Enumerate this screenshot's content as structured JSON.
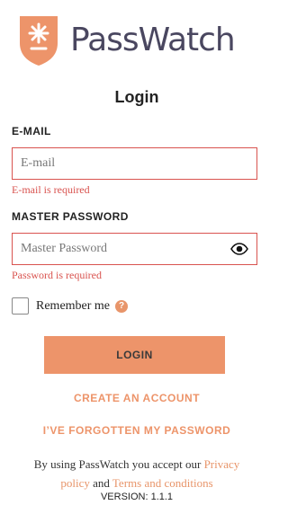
{
  "brand": {
    "name": "PassWatch",
    "logo_icon": "asterisk-shield-icon",
    "color": "#ed946a"
  },
  "page": {
    "heading": "Login"
  },
  "email": {
    "label": "E-MAIL",
    "placeholder": "E-mail",
    "value": "",
    "error": "E-mail is required"
  },
  "password": {
    "label": "MASTER PASSWORD",
    "placeholder": "Master Password",
    "value": "",
    "error": "Password is required",
    "toggle_icon": "eye-icon"
  },
  "remember": {
    "label": "Remember me",
    "checked": false,
    "help_glyph": "?"
  },
  "actions": {
    "login_label": "LOGIN",
    "create_account_label": "CREATE AN ACCOUNT",
    "forgot_label": "I’VE FORGOTTEN MY PASSWORD"
  },
  "legal": {
    "prefix": "By using PassWatch you accept our ",
    "privacy_label": "Privacy policy",
    "conjunction": " and ",
    "terms_label": "Terms and conditions"
  },
  "footer": {
    "version": "VERSION: 1.1.1"
  },
  "colors": {
    "accent": "#ed946a",
    "error": "#d9534f",
    "brand_text": "#4a4760"
  }
}
